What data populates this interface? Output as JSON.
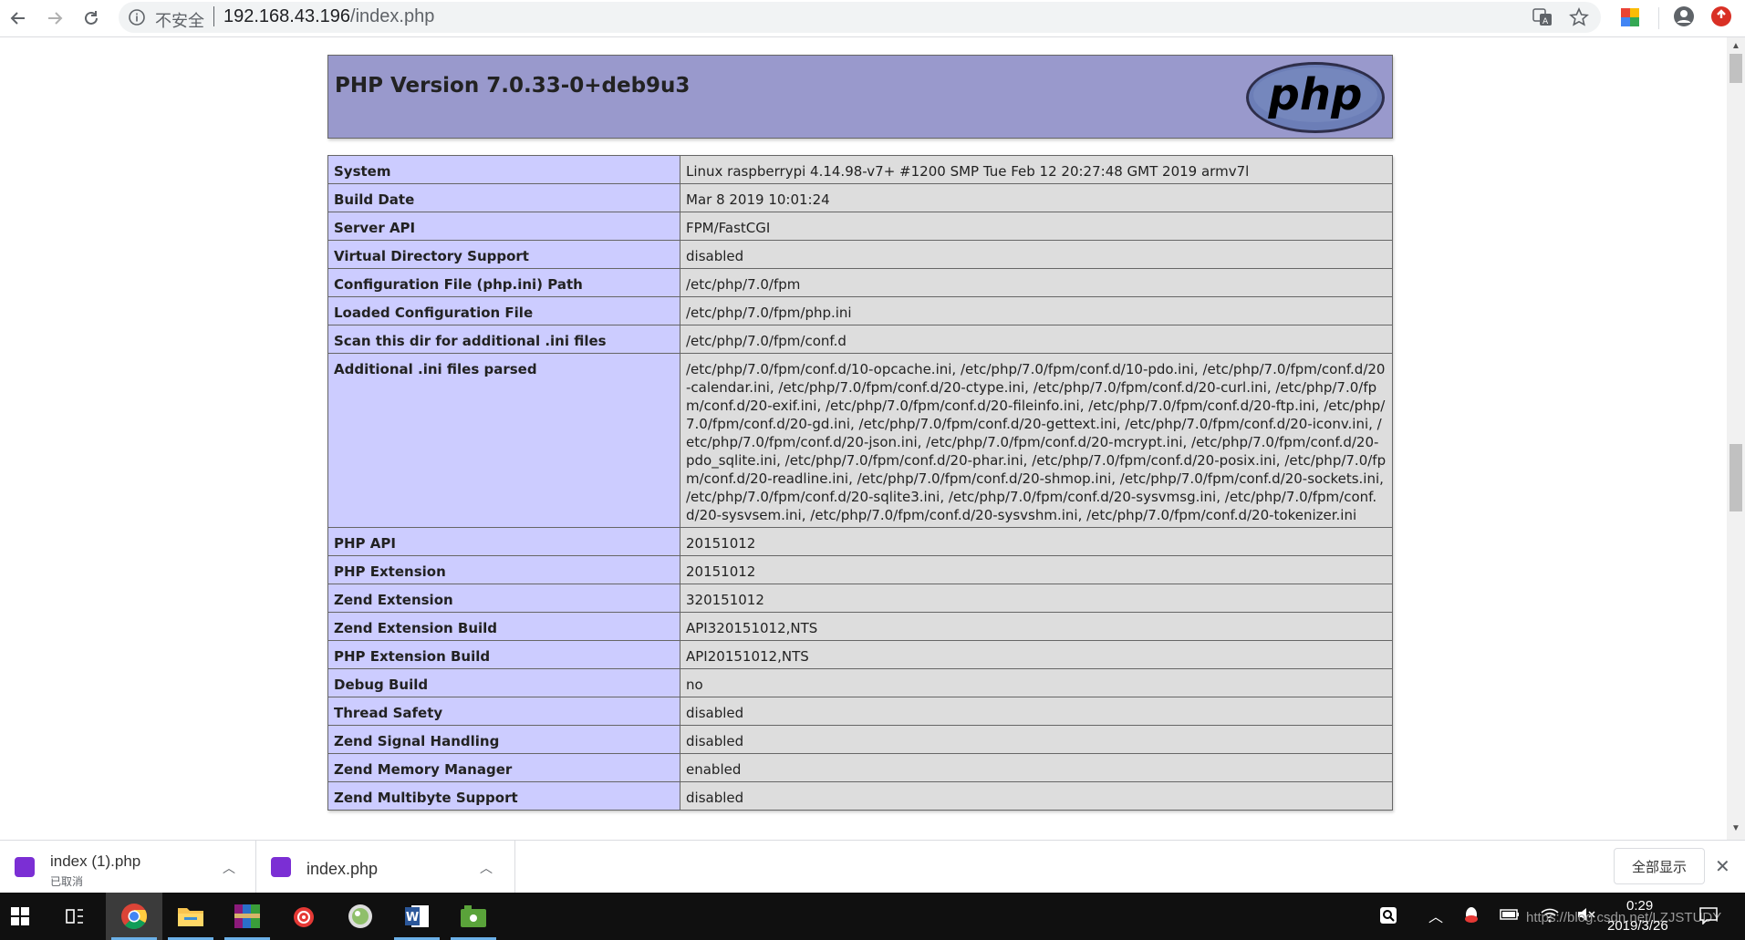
{
  "browser": {
    "security_label": "不安全",
    "url_host": "192.168.43.196",
    "url_path": "/index.php"
  },
  "phpinfo": {
    "version_title": "PHP Version 7.0.33-0+deb9u3",
    "logo_text": "php",
    "rows": [
      {
        "key": "System",
        "value": "Linux raspberrypi 4.14.98-v7+ #1200 SMP Tue Feb 12 20:27:48 GMT 2019 armv7l"
      },
      {
        "key": "Build Date",
        "value": "Mar 8 2019 10:01:24"
      },
      {
        "key": "Server API",
        "value": "FPM/FastCGI"
      },
      {
        "key": "Virtual Directory Support",
        "value": "disabled"
      },
      {
        "key": "Configuration File (php.ini) Path",
        "value": "/etc/php/7.0/fpm"
      },
      {
        "key": "Loaded Configuration File",
        "value": "/etc/php/7.0/fpm/php.ini"
      },
      {
        "key": "Scan this dir for additional .ini files",
        "value": "/etc/php/7.0/fpm/conf.d"
      },
      {
        "key": "Additional .ini files parsed",
        "value": "/etc/php/7.0/fpm/conf.d/10-opcache.ini, /etc/php/7.0/fpm/conf.d/10-pdo.ini, /etc/php/7.0/fpm/conf.d/20-calendar.ini, /etc/php/7.0/fpm/conf.d/20-ctype.ini, /etc/php/7.0/fpm/conf.d/20-curl.ini, /etc/php/7.0/fpm/conf.d/20-exif.ini, /etc/php/7.0/fpm/conf.d/20-fileinfo.ini, /etc/php/7.0/fpm/conf.d/20-ftp.ini, /etc/php/7.0/fpm/conf.d/20-gd.ini, /etc/php/7.0/fpm/conf.d/20-gettext.ini, /etc/php/7.0/fpm/conf.d/20-iconv.ini, /etc/php/7.0/fpm/conf.d/20-json.ini, /etc/php/7.0/fpm/conf.d/20-mcrypt.ini, /etc/php/7.0/fpm/conf.d/20-pdo_sqlite.ini, /etc/php/7.0/fpm/conf.d/20-phar.ini, /etc/php/7.0/fpm/conf.d/20-posix.ini, /etc/php/7.0/fpm/conf.d/20-readline.ini, /etc/php/7.0/fpm/conf.d/20-shmop.ini, /etc/php/7.0/fpm/conf.d/20-sockets.ini, /etc/php/7.0/fpm/conf.d/20-sqlite3.ini, /etc/php/7.0/fpm/conf.d/20-sysvmsg.ini, /etc/php/7.0/fpm/conf.d/20-sysvsem.ini, /etc/php/7.0/fpm/conf.d/20-sysvshm.ini, /etc/php/7.0/fpm/conf.d/20-tokenizer.ini"
      },
      {
        "key": "PHP API",
        "value": "20151012"
      },
      {
        "key": "PHP Extension",
        "value": "20151012"
      },
      {
        "key": "Zend Extension",
        "value": "320151012"
      },
      {
        "key": "Zend Extension Build",
        "value": "API320151012,NTS"
      },
      {
        "key": "PHP Extension Build",
        "value": "API20151012,NTS"
      },
      {
        "key": "Debug Build",
        "value": "no"
      },
      {
        "key": "Thread Safety",
        "value": "disabled"
      },
      {
        "key": "Zend Signal Handling",
        "value": "disabled"
      },
      {
        "key": "Zend Memory Manager",
        "value": "enabled"
      },
      {
        "key": "Zend Multibyte Support",
        "value": "disabled"
      }
    ]
  },
  "downloads": {
    "items": [
      {
        "name": "index (1).php",
        "status": "已取消"
      },
      {
        "name": "index.php"
      }
    ],
    "show_all_label": "全部显示"
  },
  "taskbar": {
    "time": "0:29",
    "date": "2019/3/26",
    "watermark": "https://blog.csdn.net/LZJSTUDY"
  },
  "colors": {
    "php_header": "#9999cc",
    "key_cell": "#ccccff",
    "value_cell": "#dddddd",
    "taskbar": "#101010"
  }
}
